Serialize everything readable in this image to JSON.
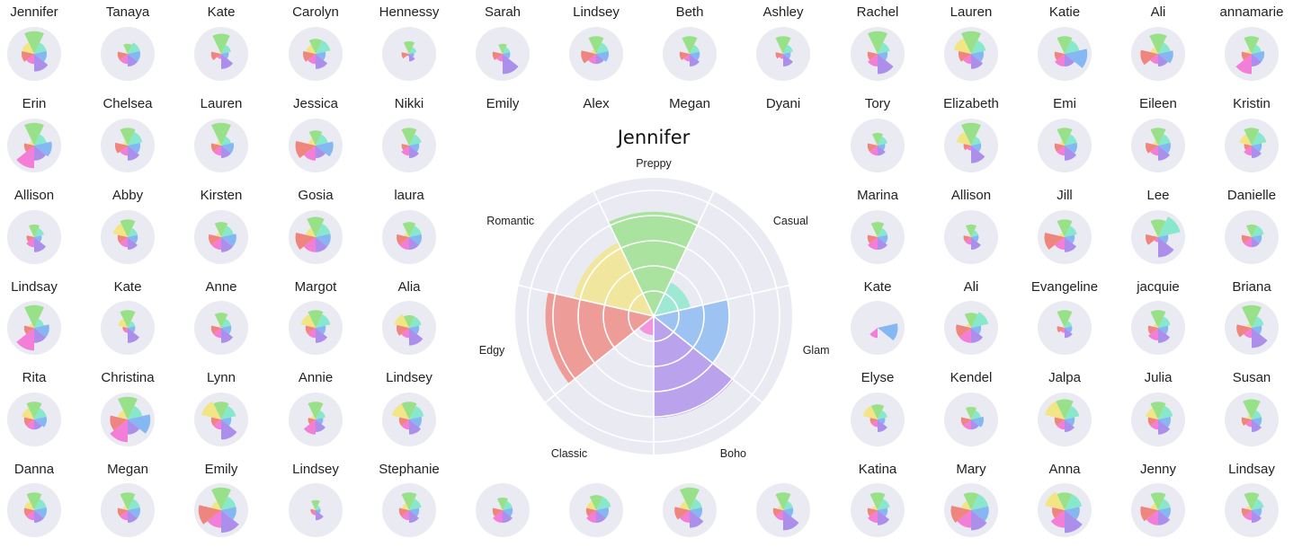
{
  "chart_data": {
    "type": "polar-bar-small-multiples",
    "categories": [
      "Preppy",
      "Casual",
      "Glam",
      "Boho",
      "Classic",
      "Edgy",
      "Romantic"
    ],
    "colors": [
      "#8fe07c",
      "#7de8c8",
      "#7ab2f2",
      "#a585ea",
      "#f472d4",
      "#f07a72",
      "#f2e47a"
    ],
    "background": "#eaeaf2",
    "rmax": 10,
    "featured": {
      "title": "Jennifer",
      "values": [
        8.3,
        3.0,
        6.0,
        8.1,
        1.5,
        8.6,
        6.5
      ]
    },
    "small_charts": [
      {
        "name": "Jennifer",
        "values": [
          9,
          5,
          5,
          7,
          4,
          5,
          5
        ]
      },
      {
        "name": "Tanaya",
        "values": [
          4,
          5,
          5,
          5,
          4,
          4,
          1
        ]
      },
      {
        "name": "Kate",
        "values": [
          8,
          4,
          3,
          6,
          2,
          4,
          1
        ]
      },
      {
        "name": "Carolyn",
        "values": [
          6,
          6,
          4,
          6,
          4,
          5,
          4
        ]
      },
      {
        "name": "Hennessy",
        "values": [
          5,
          3,
          2,
          3,
          1,
          3,
          1
        ]
      },
      {
        "name": "Sarah",
        "values": [
          4,
          3,
          3,
          8,
          3,
          4,
          1
        ]
      },
      {
        "name": "Lindsey",
        "values": [
          7,
          5,
          5,
          4,
          4,
          6,
          2
        ]
      },
      {
        "name": "Beth",
        "values": [
          7,
          4,
          4,
          5,
          3,
          4,
          1
        ]
      },
      {
        "name": "Ashley",
        "values": [
          7,
          4,
          3,
          5,
          2,
          3,
          1
        ]
      },
      {
        "name": "Rachel",
        "values": [
          9,
          5,
          4,
          8,
          5,
          4,
          1
        ]
      },
      {
        "name": "Lauren",
        "values": [
          9,
          6,
          5,
          6,
          4,
          5,
          7
        ]
      },
      {
        "name": "Katie",
        "values": [
          7,
          6,
          9,
          5,
          5,
          4,
          1
        ]
      },
      {
        "name": "Ali",
        "values": [
          8,
          5,
          6,
          5,
          4,
          7,
          3
        ]
      },
      {
        "name": "annamarie",
        "values": [
          7,
          4,
          5,
          5,
          8,
          4,
          2
        ]
      },
      {
        "name": "Erin",
        "values": [
          9,
          5,
          7,
          6,
          9,
          4,
          2
        ]
      },
      {
        "name": "Chelsea",
        "values": [
          7,
          6,
          5,
          6,
          4,
          5,
          2
        ]
      },
      {
        "name": "Lauren",
        "values": [
          9,
          4,
          5,
          5,
          4,
          4,
          2
        ]
      },
      {
        "name": "Jessica",
        "values": [
          6,
          5,
          7,
          5,
          6,
          8,
          3
        ]
      },
      {
        "name": "Nikki",
        "values": [
          7,
          5,
          4,
          5,
          4,
          3,
          1
        ]
      },
      {
        "name": "Tory",
        "values": [
          5,
          4,
          3,
          4,
          4,
          4,
          1
        ]
      },
      {
        "name": "Elizabeth",
        "values": [
          9,
          4,
          4,
          7,
          2,
          3,
          6
        ]
      },
      {
        "name": "Emi",
        "values": [
          7,
          5,
          5,
          6,
          4,
          4,
          2
        ]
      },
      {
        "name": "Eileen",
        "values": [
          7,
          5,
          5,
          6,
          4,
          5,
          2
        ]
      },
      {
        "name": "Kristin",
        "values": [
          7,
          6,
          4,
          5,
          4,
          3,
          5
        ]
      },
      {
        "name": "Allison",
        "values": [
          5,
          4,
          3,
          6,
          4,
          3,
          1
        ]
      },
      {
        "name": "Abby",
        "values": [
          7,
          4,
          4,
          5,
          4,
          4,
          6
        ]
      },
      {
        "name": "Kirsten",
        "values": [
          6,
          5,
          6,
          6,
          5,
          5,
          2
        ]
      },
      {
        "name": "Gosia",
        "values": [
          8,
          6,
          6,
          6,
          6,
          8,
          4
        ]
      },
      {
        "name": "laura",
        "values": [
          6,
          5,
          5,
          5,
          5,
          5,
          2
        ]
      },
      {
        "name": "Marina",
        "values": [
          6,
          4,
          4,
          5,
          5,
          4,
          1
        ]
      },
      {
        "name": "Allison",
        "values": [
          5,
          3,
          3,
          5,
          3,
          3,
          1
        ]
      },
      {
        "name": "Jill",
        "values": [
          7,
          5,
          4,
          6,
          5,
          8,
          2
        ]
      },
      {
        "name": "Lee",
        "values": [
          7,
          9,
          4,
          8,
          2,
          5,
          1
        ]
      },
      {
        "name": "Danielle",
        "values": [
          5,
          5,
          4,
          4,
          4,
          4,
          1
        ]
      },
      {
        "name": "Lindsay",
        "values": [
          9,
          4,
          6,
          6,
          9,
          4,
          2
        ]
      },
      {
        "name": "Kate",
        "values": [
          7,
          3,
          3,
          6,
          2,
          2,
          4
        ]
      },
      {
        "name": "Anne",
        "values": [
          6,
          4,
          4,
          6,
          4,
          4,
          1
        ]
      },
      {
        "name": "Margot",
        "values": [
          7,
          6,
          4,
          6,
          4,
          4,
          6
        ]
      },
      {
        "name": "Alia",
        "values": [
          5,
          5,
          4,
          7,
          4,
          5,
          6
        ]
      },
      {
        "name": "Kate",
        "values": [
          0,
          0,
          8,
          0,
          4,
          0,
          0
        ]
      },
      {
        "name": "Ali",
        "values": [
          6,
          7,
          4,
          6,
          6,
          6,
          2
        ]
      },
      {
        "name": "Evangeline",
        "values": [
          7,
          3,
          3,
          4,
          2,
          3,
          1
        ]
      },
      {
        "name": "jacquie",
        "values": [
          7,
          5,
          4,
          6,
          5,
          4,
          2
        ]
      },
      {
        "name": "Briana",
        "values": [
          9,
          5,
          4,
          8,
          4,
          6,
          2
        ]
      },
      {
        "name": "Rita",
        "values": [
          7,
          5,
          5,
          4,
          4,
          4,
          5
        ]
      },
      {
        "name": "Christina",
        "values": [
          9,
          6,
          9,
          6,
          9,
          7,
          4
        ]
      },
      {
        "name": "Lynn",
        "values": [
          7,
          6,
          4,
          8,
          4,
          4,
          8
        ]
      },
      {
        "name": "Annie",
        "values": [
          7,
          4,
          3,
          5,
          6,
          3,
          2
        ]
      },
      {
        "name": "Lindsey",
        "values": [
          7,
          6,
          5,
          6,
          4,
          4,
          7
        ]
      },
      {
        "name": "Elyse",
        "values": [
          6,
          4,
          3,
          5,
          3,
          3,
          6
        ]
      },
      {
        "name": "Kendel",
        "values": [
          5,
          4,
          5,
          4,
          4,
          4,
          1
        ]
      },
      {
        "name": "Jalpa",
        "values": [
          8,
          6,
          4,
          5,
          4,
          4,
          8
        ]
      },
      {
        "name": "Julia",
        "values": [
          7,
          6,
          5,
          6,
          4,
          4,
          5
        ]
      },
      {
        "name": "Susan",
        "values": [
          8,
          4,
          4,
          5,
          3,
          4,
          2
        ]
      },
      {
        "name": "Danna",
        "values": [
          7,
          5,
          5,
          5,
          4,
          4,
          4
        ]
      },
      {
        "name": "Megan",
        "values": [
          7,
          5,
          5,
          5,
          4,
          4,
          2
        ]
      },
      {
        "name": "Emily",
        "values": [
          9,
          6,
          6,
          9,
          7,
          9,
          4
        ]
      },
      {
        "name": "Lindsey",
        "values": [
          4,
          2,
          2,
          4,
          2,
          2,
          1
        ]
      },
      {
        "name": "Stephanie",
        "values": [
          7,
          5,
          4,
          5,
          4,
          4,
          3
        ]
      },
      {
        "name": "Emily",
        "values": [
          5,
          4,
          4,
          5,
          5,
          4,
          1
        ]
      },
      {
        "name": "Alex",
        "values": [
          6,
          6,
          5,
          5,
          5,
          4,
          4
        ]
      },
      {
        "name": "Megan",
        "values": [
          9,
          5,
          5,
          7,
          5,
          6,
          4
        ]
      },
      {
        "name": "Dyani",
        "values": [
          7,
          4,
          4,
          8,
          4,
          4,
          2
        ]
      },
      {
        "name": "Katina",
        "values": [
          7,
          5,
          4,
          6,
          5,
          4,
          2
        ]
      },
      {
        "name": "Mary",
        "values": [
          7,
          7,
          7,
          8,
          7,
          8,
          4
        ]
      },
      {
        "name": "Anna",
        "values": [
          7,
          7,
          6,
          9,
          7,
          5,
          8
        ]
      },
      {
        "name": "Jenny",
        "values": [
          7,
          5,
          5,
          6,
          6,
          7,
          3
        ]
      },
      {
        "name": "Lindsay",
        "values": [
          7,
          5,
          4,
          5,
          4,
          4,
          2
        ]
      }
    ]
  }
}
